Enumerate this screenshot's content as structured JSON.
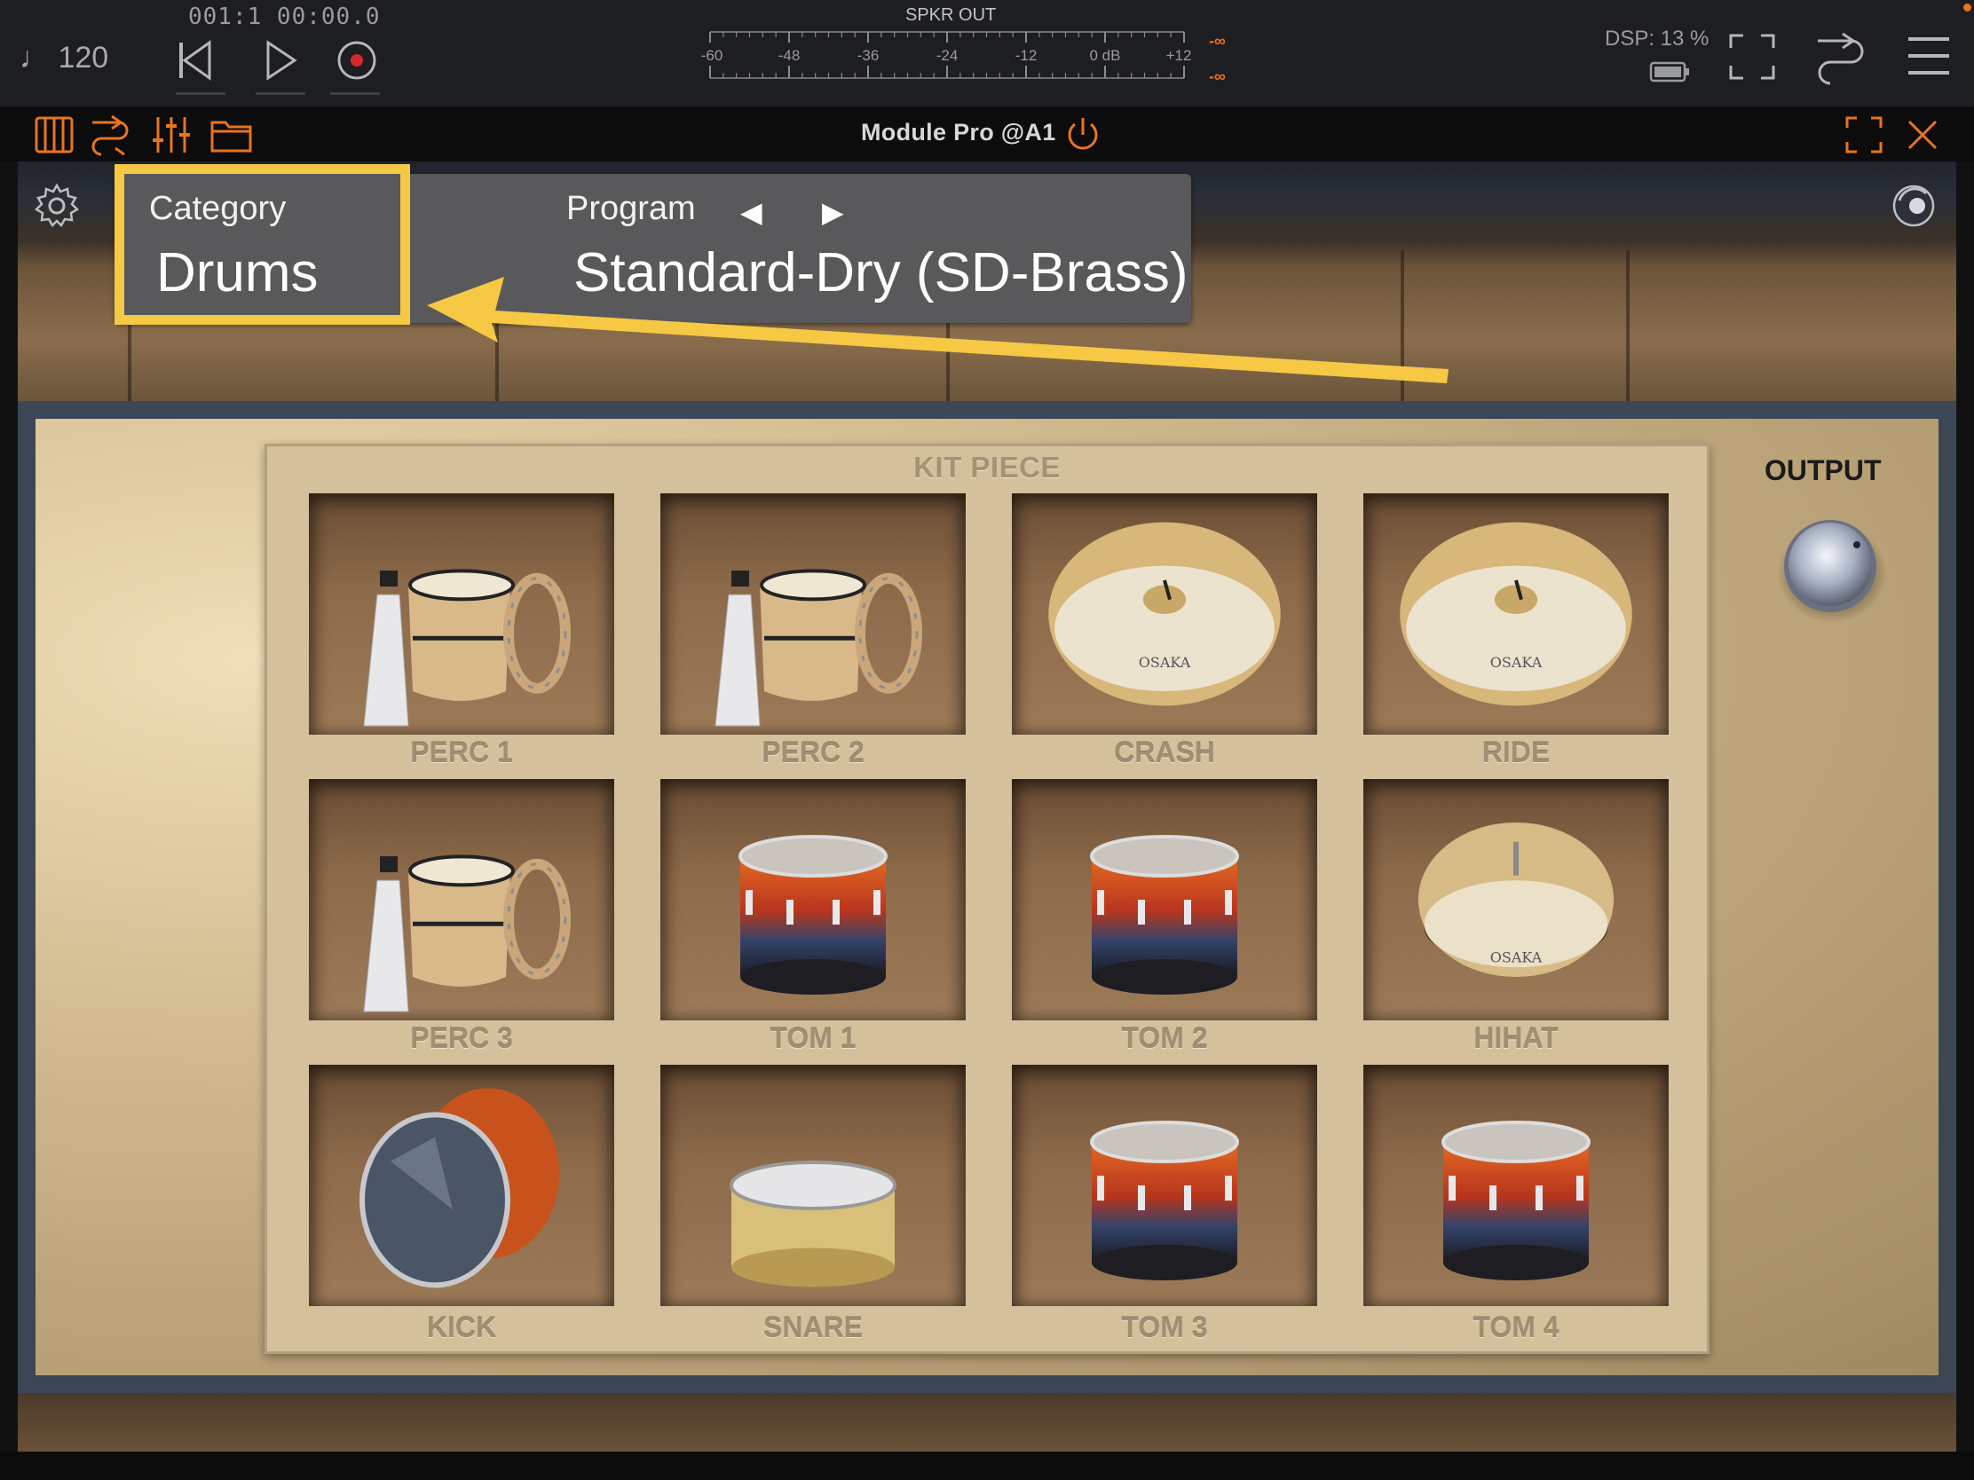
{
  "transport": {
    "tempo": "♩ 120",
    "position": "001:1   00:00.0",
    "meter_title": "SPKR OUT",
    "meter_ticks": [
      "-60",
      "-48",
      "-36",
      "-24",
      "-12",
      "0 dB",
      "+12"
    ],
    "meter_peak_top": "-∞",
    "meter_peak_bottom": "-∞",
    "dsp": "DSP: 13 %"
  },
  "plugin": {
    "title": "Module Pro @A1"
  },
  "browser": {
    "category_label": "Category",
    "category_value": "Drums",
    "program_label": "Program",
    "prev_arrow": "◀",
    "next_arrow": "▶",
    "program_value": "Standard-Dry (SD-Brass)"
  },
  "kit": {
    "title": "KIT PIECE",
    "rows": [
      [
        {
          "label": "PERC 1",
          "icon": "percussion-icon"
        },
        {
          "label": "PERC 2",
          "icon": "percussion-icon"
        },
        {
          "label": "CRASH",
          "icon": "cymbal-icon"
        },
        {
          "label": "RIDE",
          "icon": "cymbal-icon"
        }
      ],
      [
        {
          "label": "PERC 3",
          "icon": "percussion-icon"
        },
        {
          "label": "TOM 1",
          "icon": "drum-icon"
        },
        {
          "label": "TOM 2",
          "icon": "drum-icon"
        },
        {
          "label": "HIHAT",
          "icon": "hihat-icon"
        }
      ],
      [
        {
          "label": "KICK",
          "icon": "kick-drum-icon"
        },
        {
          "label": "SNARE",
          "icon": "snare-drum-icon"
        },
        {
          "label": "TOM 3",
          "icon": "drum-icon"
        },
        {
          "label": "TOM 4",
          "icon": "drum-icon"
        }
      ]
    ],
    "cymbal_brand": "OSAKA"
  },
  "output": {
    "label": "OUTPUT"
  },
  "colors": {
    "highlight": "#f6c844",
    "accent": "#e8741e",
    "panel_gray": "#59595b"
  }
}
